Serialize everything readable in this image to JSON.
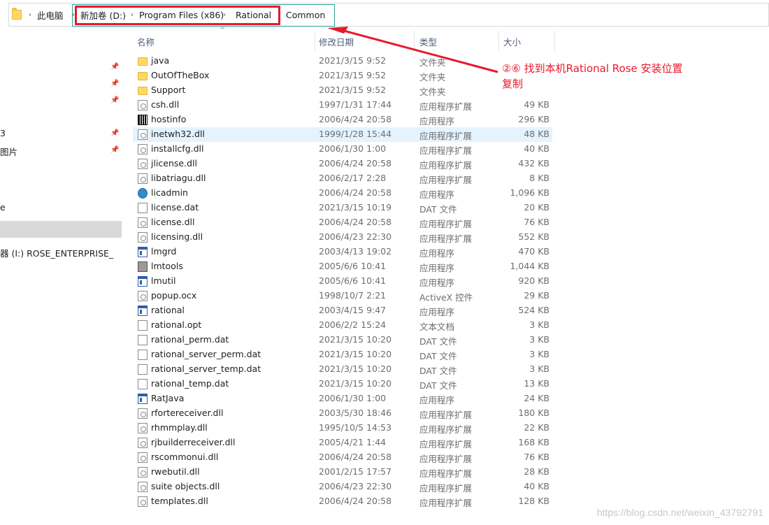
{
  "address_bar": {
    "breadcrumbs": [
      "此电脑",
      "新加卷 (D:)",
      "Program Files (x86)",
      "Rational",
      "Common"
    ]
  },
  "sidebar": {
    "items": [
      {
        "label": "3"
      },
      {
        "label": "图片"
      },
      {
        "label": "e"
      },
      {
        "label": "器 (I:) ROSE_ENTERPRISE_"
      }
    ]
  },
  "columns": {
    "name": "名称",
    "date": "修改日期",
    "type": "类型",
    "size": "大小"
  },
  "files": [
    {
      "name": "java",
      "date": "2021/3/15 9:52",
      "type": "文件夹",
      "size": "",
      "icon": "folder-icon"
    },
    {
      "name": "OutOfTheBox",
      "date": "2021/3/15 9:52",
      "type": "文件夹",
      "size": "",
      "icon": "folder-icon"
    },
    {
      "name": "Support",
      "date": "2021/3/15 9:52",
      "type": "文件夹",
      "size": "",
      "icon": "folder-icon"
    },
    {
      "name": "csh.dll",
      "date": "1997/1/31 17:44",
      "type": "应用程序扩展",
      "size": "49 KB",
      "icon": "dll-icon"
    },
    {
      "name": "hostinfo",
      "date": "2006/4/24 20:58",
      "type": "应用程序",
      "size": "296 KB",
      "icon": "barcode-app-icon"
    },
    {
      "name": "inetwh32.dll",
      "date": "1999/1/28 15:44",
      "type": "应用程序扩展",
      "size": "48 KB",
      "icon": "dll-icon"
    },
    {
      "name": "installcfg.dll",
      "date": "2006/1/30 1:00",
      "type": "应用程序扩展",
      "size": "40 KB",
      "icon": "dll-icon"
    },
    {
      "name": "jlicense.dll",
      "date": "2006/4/24 20:58",
      "type": "应用程序扩展",
      "size": "432 KB",
      "icon": "dll-icon"
    },
    {
      "name": "libatriagu.dll",
      "date": "2006/2/17 2:28",
      "type": "应用程序扩展",
      "size": "8 KB",
      "icon": "dll-icon"
    },
    {
      "name": "licadmin",
      "date": "2006/4/24 20:58",
      "type": "应用程序",
      "size": "1,096 KB",
      "icon": "globe-app-icon"
    },
    {
      "name": "license.dat",
      "date": "2021/3/15 10:19",
      "type": "DAT 文件",
      "size": "20 KB",
      "icon": "file-icon"
    },
    {
      "name": "license.dll",
      "date": "2006/4/24 20:58",
      "type": "应用程序扩展",
      "size": "76 KB",
      "icon": "dll-icon"
    },
    {
      "name": "licensing.dll",
      "date": "2006/4/23 22:30",
      "type": "应用程序扩展",
      "size": "552 KB",
      "icon": "dll-icon"
    },
    {
      "name": "lmgrd",
      "date": "2003/4/13 19:02",
      "type": "应用程序",
      "size": "470 KB",
      "icon": "app-icon"
    },
    {
      "name": "lmtools",
      "date": "2005/6/6 10:41",
      "type": "应用程序",
      "size": "1,044 KB",
      "icon": "tools-app-icon"
    },
    {
      "name": "lmutil",
      "date": "2005/6/6 10:41",
      "type": "应用程序",
      "size": "920 KB",
      "icon": "app-icon"
    },
    {
      "name": "popup.ocx",
      "date": "1998/10/7 2:21",
      "type": "ActiveX 控件",
      "size": "29 KB",
      "icon": "dll-icon"
    },
    {
      "name": "rational",
      "date": "2003/4/15 9:47",
      "type": "应用程序",
      "size": "524 KB",
      "icon": "app-icon"
    },
    {
      "name": "rational.opt",
      "date": "2006/2/2 15:24",
      "type": "文本文档",
      "size": "3 KB",
      "icon": "file-icon"
    },
    {
      "name": "rational_perm.dat",
      "date": "2021/3/15 10:20",
      "type": "DAT 文件",
      "size": "3 KB",
      "icon": "file-icon"
    },
    {
      "name": "rational_server_perm.dat",
      "date": "2021/3/15 10:20",
      "type": "DAT 文件",
      "size": "3 KB",
      "icon": "file-icon"
    },
    {
      "name": "rational_server_temp.dat",
      "date": "2021/3/15 10:20",
      "type": "DAT 文件",
      "size": "3 KB",
      "icon": "file-icon"
    },
    {
      "name": "rational_temp.dat",
      "date": "2021/3/15 10:20",
      "type": "DAT 文件",
      "size": "13 KB",
      "icon": "file-icon"
    },
    {
      "name": "RatJava",
      "date": "2006/1/30 1:00",
      "type": "应用程序",
      "size": "24 KB",
      "icon": "app-icon"
    },
    {
      "name": "rfortereceiver.dll",
      "date": "2003/5/30 18:46",
      "type": "应用程序扩展",
      "size": "180 KB",
      "icon": "dll-icon"
    },
    {
      "name": "rhmmplay.dll",
      "date": "1995/10/5 14:53",
      "type": "应用程序扩展",
      "size": "22 KB",
      "icon": "dll-icon"
    },
    {
      "name": "rjbuilderreceiver.dll",
      "date": "2005/4/21 1:44",
      "type": "应用程序扩展",
      "size": "168 KB",
      "icon": "dll-icon"
    },
    {
      "name": "rscommonui.dll",
      "date": "2006/4/24 20:58",
      "type": "应用程序扩展",
      "size": "76 KB",
      "icon": "dll-icon"
    },
    {
      "name": "rwebutil.dll",
      "date": "2001/2/15 17:57",
      "type": "应用程序扩展",
      "size": "28 KB",
      "icon": "dll-icon"
    },
    {
      "name": "suite objects.dll",
      "date": "2006/4/23 22:30",
      "type": "应用程序扩展",
      "size": "40 KB",
      "icon": "dll-icon"
    },
    {
      "name": "templates.dll",
      "date": "2006/4/24 20:58",
      "type": "应用程序扩展",
      "size": "128 KB",
      "icon": "dll-icon"
    }
  ],
  "selected_file": "inetwh32.dll",
  "annotation": {
    "line1": "②⑥ 找到本机Rational Rose 安装位置",
    "line2": "复制",
    "color": "#e8192b"
  },
  "watermark": "https://blog.csdn.net/weixin_43792791"
}
